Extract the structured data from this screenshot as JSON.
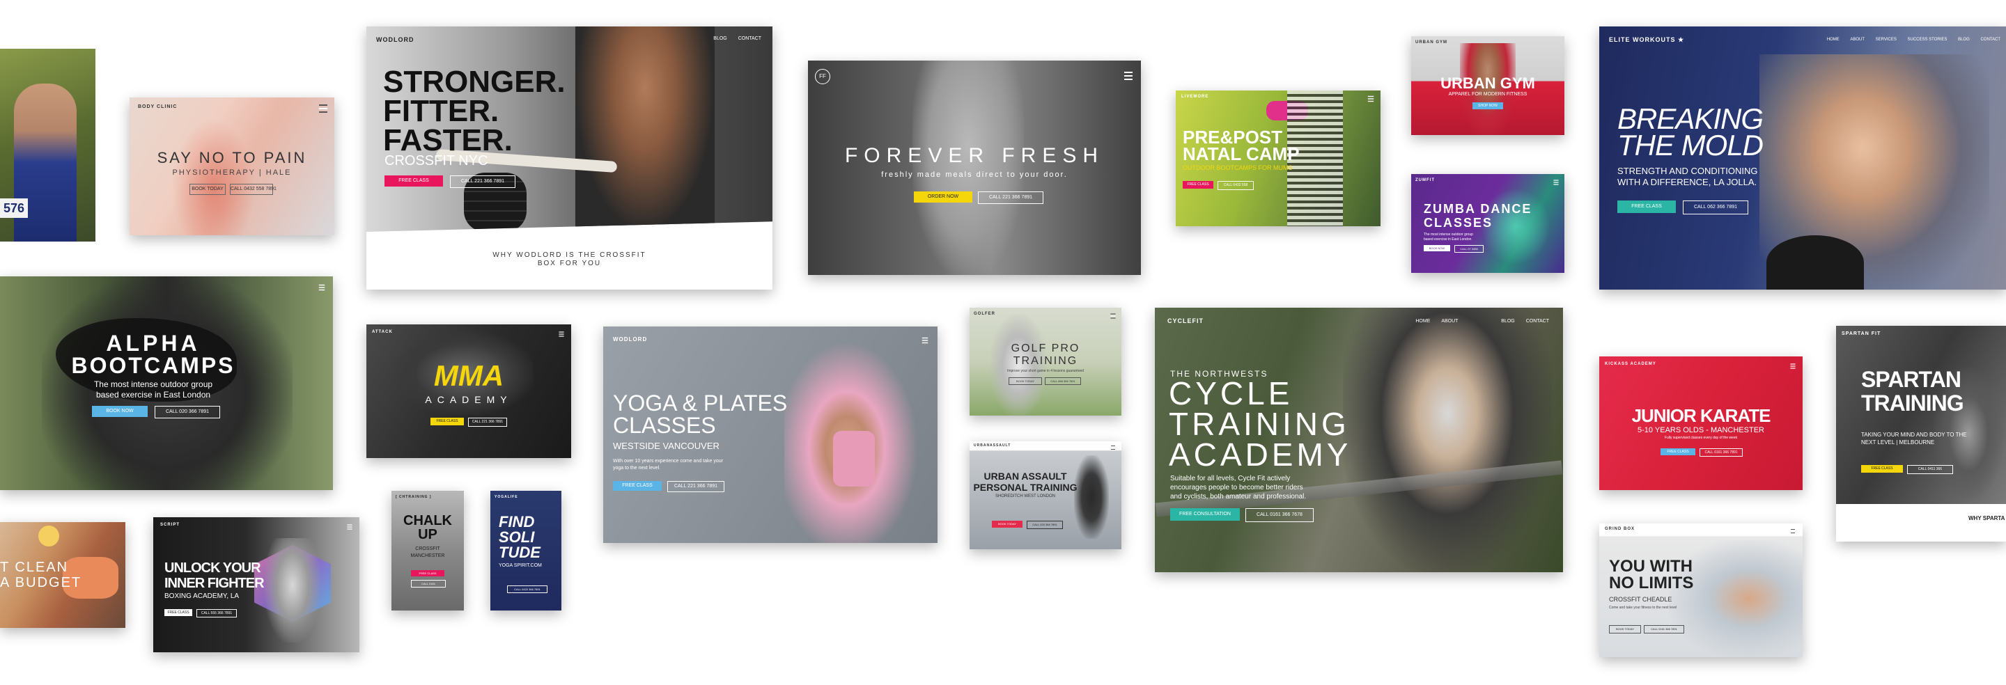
{
  "colors": {
    "pink": "#e8175d",
    "yellow": "#f5d60a",
    "teal": "#2bb5a5",
    "blue": "#5ab4e6",
    "navy": "#1f2a5e",
    "purple": "#6b2c9c",
    "red": "#e52b4b"
  },
  "cards": {
    "runner": {
      "bib": "576"
    },
    "bodyclinic": {
      "logo": "BODY CLINIC",
      "title": "SAY NO TO PAIN",
      "subtitle": "PHYSIOTHERAPY | HALE",
      "btn1": "BOOK TODAY",
      "btn2": "CALL 0432 558 7891"
    },
    "wodlord_crossfit": {
      "logo": "WODLORD",
      "nav": [
        "BLOG",
        "CONTACT"
      ],
      "h1": "STRONGER.",
      "h2": "FITTER.",
      "h3": "FASTER.",
      "sub": "CROSSFIT NYC",
      "btn1": "FREE CLASS",
      "btn2": "CALL 221 366 7891",
      "footer1": "WHY WODLORD IS THE CROSSFIT",
      "footer2": "BOX FOR YOU"
    },
    "forever": {
      "logo": "FF",
      "title": "FOREVER FRESH",
      "sub": "freshly made meals direct to your door.",
      "btn1": "ORDER NOW",
      "btn2": "CALL 221 366 7891"
    },
    "natal": {
      "logo": "LIVEMORE",
      "h1": "PRE&POST",
      "h2": "NATAL CAMP",
      "sub": "OUTDOOR BOOTCAMPS FOR MUMS",
      "btn1": "FREE CLASS",
      "btn2": "CALL 0432 558"
    },
    "urbangym": {
      "logo": "URBAN GYM",
      "title": "URBAN GYM",
      "sub": "APPAREL FOR MODERN FITNESS",
      "btn": "SHOP NOW"
    },
    "zumba": {
      "logo": "ZUMFIT",
      "h1": "ZUMBA DANCE",
      "h2": "CLASSES",
      "sub1": "The most intense outdoor group",
      "sub2": "based exercise in East London",
      "btn1": "BOOK NOW",
      "btn2": "CALL 07 3456"
    },
    "elite": {
      "logo": "ELITE WORKOUTS ★",
      "nav": [
        "HOME",
        "ABOUT",
        "SERVICES",
        "SUCCESS STORIES",
        "BLOG",
        "CONTACT"
      ],
      "h1": "BREAKING",
      "h2": "THE MOLD",
      "sub1": "STRENGTH AND CONDITIONING",
      "sub2": "WITH A DIFFERENCE, LA JOLLA.",
      "btn1": "FREE CLASS",
      "btn2": "CALL 062 366 7891"
    },
    "alpha": {
      "h1": "ALPHA",
      "h2": "BOOTCAMPS",
      "sub1": "The most intense outdoor group",
      "sub2": "based exercise in East London",
      "btn1": "BOOK NOW",
      "btn2": "CALL 020 366 7891"
    },
    "mma": {
      "logo": "ATTACK",
      "title": "MMA",
      "sub": "ACADEMY",
      "btn1": "FREE CLASS",
      "btn2": "CALL 221 366 7891"
    },
    "yoga": {
      "logo": "WODLORD",
      "h1": "YOGA & PLATES",
      "h2": "CLASSES",
      "sub": "WESTSIDE VANCOUVER",
      "desc1": "With over 10 years experience come and take your",
      "desc2": "yoga to the next level.",
      "btn1": "FREE CLASS",
      "btn2": "CALL 221 366 7891"
    },
    "golf": {
      "logo": "GOLFER",
      "h1": "GOLF PRO",
      "h2": "TRAINING",
      "sub": "Improve your short game in 4 lessons guaranteed",
      "btn1": "BOOK TODAY",
      "btn2": "CALL 866 366 7891"
    },
    "urbanassault": {
      "logo": "URBANASSAULT",
      "h1": "URBAN ASSAULT",
      "h2": "PERSONAL TRAINING",
      "sub": "SHOREDITCH WEST LONDON",
      "btn1": "BOOK TODAY",
      "btn2": "CALL 020 366 7891"
    },
    "cyclefit": {
      "logo": "CYCLEFIT",
      "nav": [
        "HOME",
        "ABOUT",
        "BLOG",
        "CONTACT"
      ],
      "pre": "THE NORTHWESTS",
      "h1": "CYCLE",
      "h2": "TRAINING",
      "h3": "ACADEMY",
      "sub1": "Suitable for all levels, Cycle Fit actively",
      "sub2": "encourages people to become better riders",
      "sub3": "and cyclists, both amateur and professional.",
      "btn1": "FREE CONSULTATION",
      "btn2": "CALL 0161 366 7678"
    },
    "karate": {
      "logo": "KICKASS ACADEMY",
      "title": "JUNIOR KARATE",
      "sub": "5-10 YEARS OLDS - MANCHESTER",
      "desc": "Fully supervised classes every day of the week",
      "btn1": "FREE CLASS",
      "btn2": "CALL 0161 366 7891"
    },
    "spartan": {
      "logo": "SPARTAN FIT",
      "h1": "SPARTAN",
      "h2": "TRAINING",
      "sub1": "TAKING YOUR MIND AND BODY TO THE",
      "sub2": "NEXT LEVEL | MELBOURNE",
      "btn1": "FREE CLASS",
      "btn2": "CALL 0411 366",
      "footer": "WHY SPARTA"
    },
    "clean": {
      "h1": "T CLEAN",
      "h2": "A BUDGET"
    },
    "fighter": {
      "logo": "SCRIPT",
      "h1": "UNLOCK YOUR",
      "h2": "INNER FIGHTER",
      "sub": "BOXING ACADEMY, LA",
      "btn1": "FREE CLASS",
      "btn2": "CALL 555 366 7891"
    },
    "chalk": {
      "logo": "[ CHTRAINING ]",
      "h1": "CHALK",
      "h2": "UP",
      "sub1": "CROSSFIT",
      "sub2": "MANCHESTER",
      "btn1": "FREE CLASS",
      "btn2": "CALL 0161"
    },
    "soli": {
      "logo": "YOGALIFE",
      "h1": "FIND",
      "h2": "SOLI",
      "h3": "TUDE",
      "sub": "YOGA SPIRIT.COM",
      "btn": "CALL 0422 366 7891"
    },
    "limits": {
      "logo": "GRIND BOX",
      "h1": "YOU WITH",
      "h2": "NO LIMITS",
      "sub": "CROSSFIT CHEADLE",
      "desc": "Come and take your fitness to the next level",
      "btn1": "BOOK TODAY",
      "btn2": "CALL 0161 366 7891"
    }
  }
}
